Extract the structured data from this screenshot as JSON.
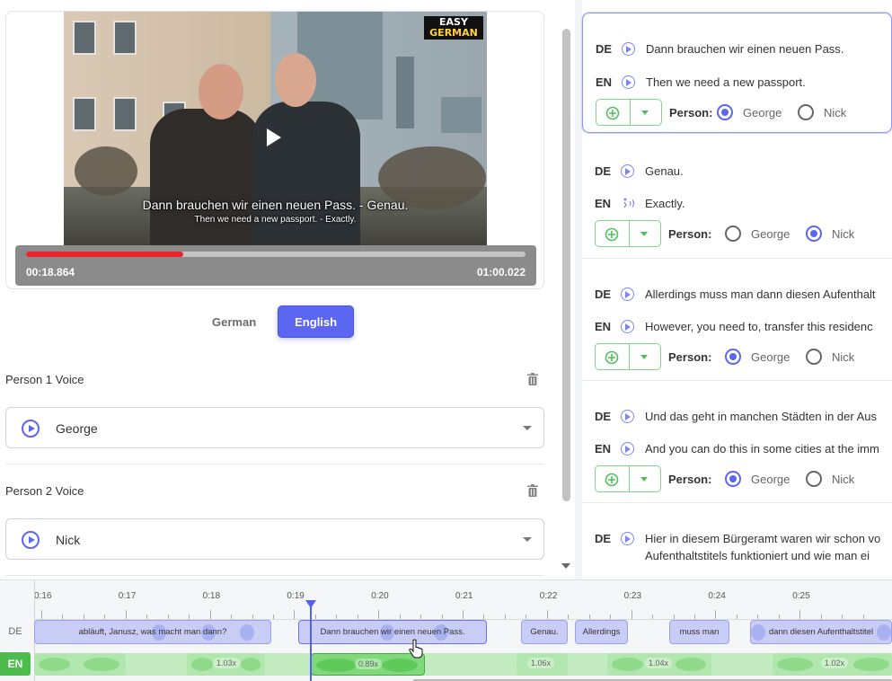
{
  "video": {
    "logo_line1": "EASY",
    "logo_line2": "GERMAN",
    "subtitle_de": "Dann brauchen wir einen neuen Pass. - Genau.",
    "subtitle_en": "Then we need a new passport. - Exactly.",
    "current_time": "00:18.864",
    "duration": "01:00.022",
    "progress_fraction": 0.314
  },
  "lang_tabs": [
    {
      "label": "German",
      "active": false
    },
    {
      "label": "English",
      "active": true
    }
  ],
  "voices": [
    {
      "title": "Person 1 Voice",
      "value": "George"
    },
    {
      "title": "Person 2 Voice",
      "value": "Nick"
    }
  ],
  "segments": [
    {
      "de": "Dann brauchen wir einen neuen Pass.",
      "en": "Then we need a new passport.",
      "person": "George",
      "active": true,
      "en_icon": "play"
    },
    {
      "de": "Genau.",
      "en": "Exactly.",
      "person": "Nick",
      "active": false,
      "en_icon": "wave"
    },
    {
      "de": "Allerdings muss man dann diesen Aufenthalt",
      "en": "However, you need to, transfer this residenc",
      "person": "George",
      "active": false,
      "en_icon": "play"
    },
    {
      "de": "Und das geht in manchen Städten in der Aus",
      "en": "And you can do this in some cities at the imm",
      "person": "George",
      "active": false,
      "en_icon": "play"
    },
    {
      "de": "Hier in diesem Bürgeramt waren wir schon vo",
      "de2": "Aufenthaltstitels funktioniert und wie man ei",
      "active": false
    }
  ],
  "segment_labels": {
    "de": "DE",
    "en": "EN",
    "person": "Person:",
    "option_a": "George",
    "option_b": "Nick"
  },
  "timeline": {
    "track_de": "DE",
    "track_en": "EN",
    "ticks": [
      "0:16",
      "0:17",
      "0:18",
      "0:19",
      "0:20",
      "0:21",
      "0:22",
      "0:23",
      "0:24",
      "0:25"
    ],
    "de_clips": [
      {
        "text": "abläuft, Janusz, was macht man dann?"
      },
      {
        "text": "Dann brauchen wir einen neuen Pass.",
        "selected": true
      },
      {
        "text": "Genau."
      },
      {
        "text": "Allerdings"
      },
      {
        "text": "muss man"
      },
      {
        "text": "dann diesen Aufenthaltstitel"
      }
    ],
    "en_speeds": [
      "1.03x",
      "0.89x",
      "1.06x",
      "1.04x",
      "1.02x"
    ]
  },
  "colors": {
    "accent": "#5b67f0",
    "progress": "#e8252c",
    "en_green": "#4cbd4c"
  }
}
